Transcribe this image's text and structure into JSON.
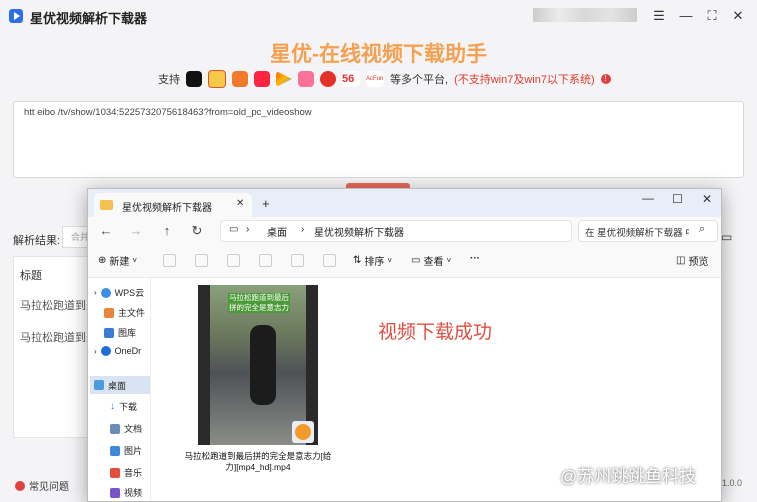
{
  "app": {
    "title": "星优视频解析下载器",
    "hero_title": "星优-在线视频下载助手",
    "support_prefix": "支持",
    "support_suffix": "等多个平台,",
    "support_note": "(不支持win7及win7以下系统)",
    "platform_icons": [
      "tiktok-icon",
      "weibo-icon",
      "kuaishou-icon",
      "xiaohongshu-icon",
      "tencent-video-icon",
      "bilibili-icon",
      "cctv-icon",
      "acfun-56-icon",
      "acfun-icon"
    ],
    "url_value": "htt     eibo     /tv/show/1034:5225732075618463?from=old_pc_videoshow",
    "result_label": "解析结果:",
    "result_select": "合并",
    "table_header": "标题",
    "row1": "马拉松跑道到最后",
    "row2": "马拉松跑道到最后",
    "help_label": "常见问题",
    "version": "1.0.0",
    "watermark": "@苏州跳跳鱼科技"
  },
  "explorer": {
    "tab_title": "星优视频解析下载器",
    "breadcrumb": [
      "桌面",
      "星优视频解析下载器"
    ],
    "search_placeholder": "在 星优视频解析下载器 中",
    "new_label": "新建",
    "sort_label": "排序",
    "view_label": "查看",
    "preview_label": "预览",
    "sidebar": [
      "WPS云",
      "主文件",
      "图库",
      "OneDr",
      "桌面",
      "下载",
      "文档",
      "图片",
      "音乐",
      "视频"
    ],
    "thumb_caption": "马拉松跑道到最后拼的完全是意志力",
    "file_name": "马拉松跑道到最后拼的完全是意志力[给力][mp4_hd].mp4",
    "success_text": "视频下载成功"
  },
  "colors": {
    "accent": "#f5a050",
    "warn": "#e03a2e",
    "button": "#e86a5a",
    "success": "#e04e3f"
  }
}
